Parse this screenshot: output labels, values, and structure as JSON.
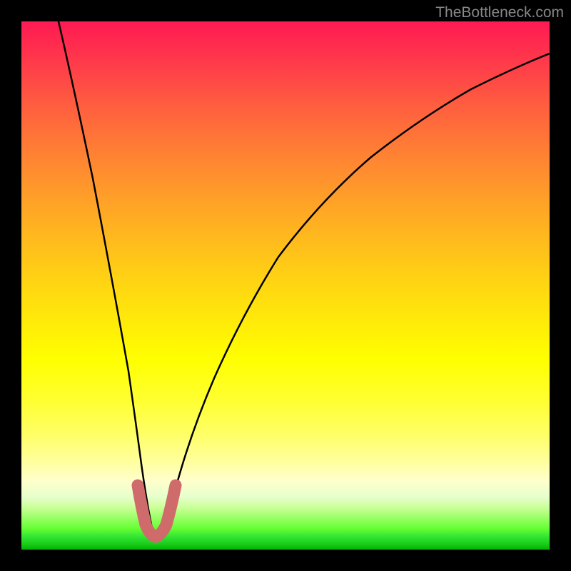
{
  "watermark": "TheBottleneck.com",
  "chart_data": {
    "type": "line",
    "title": "",
    "xlabel": "",
    "ylabel": "",
    "xlim": [
      0,
      100
    ],
    "ylim": [
      0,
      100
    ],
    "description": "Bottleneck curve plot with rainbow gradient background. The curve resembles a V-shape with a minimum near x=25. The background gradient goes from red (top, high bottleneck) through orange, yellow, to green (bottom, optimal).",
    "series": [
      {
        "name": "bottleneck-curve",
        "type": "line",
        "color": "#000000",
        "x": [
          7,
          10,
          13,
          16,
          19,
          21,
          23,
          24.5,
          26,
          28,
          30,
          33,
          37,
          42,
          48,
          55,
          63,
          72,
          82,
          93,
          100
        ],
        "y": [
          100,
          85,
          70,
          55,
          40,
          28,
          17,
          9,
          4,
          9,
          17,
          28,
          40,
          52,
          63,
          72,
          79,
          85,
          90,
          94,
          96
        ]
      },
      {
        "name": "minimum-marker",
        "type": "line",
        "color": "#d16868",
        "stroke_width": 14,
        "x": [
          21.5,
          22.5,
          23.5,
          24.5,
          25.5,
          26.5,
          27.5,
          28.5
        ],
        "y": [
          12,
          7,
          3,
          1.5,
          1.5,
          3,
          7,
          12
        ]
      }
    ],
    "gradient_colors": {
      "top": "#ff1a53",
      "middle": "#ffff00",
      "bottom": "#00b300"
    }
  }
}
